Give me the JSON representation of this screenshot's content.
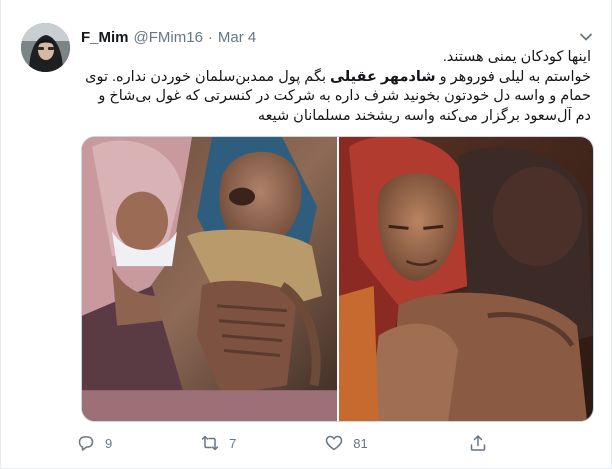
{
  "tweet": {
    "author_name": "F_Mim",
    "handle": "@FMim16",
    "separator": "·",
    "date": "Mar 4",
    "lines": [
      {
        "before": "",
        "bold": "",
        "after": "اینها کودکان یمنی هستند."
      },
      {
        "before": "خواستم به لیلی فوروهر و ",
        "bold": "شادمهر عقیلی",
        "after": " بگم پول ممدبن‌سلمان خوردن نداره. توی"
      },
      {
        "before": "",
        "bold": "",
        "after": "حمام و واسه دل خودتون بخونید شرف داره به شرکت در کنسرتی که غول بی‌شاخ و"
      },
      {
        "before": "",
        "bold": "",
        "after": "دم آل‌سعود برگزار می‌کنه واسه ریشخند مسلمانان شیعه"
      }
    ]
  },
  "actions": {
    "reply_count": "9",
    "retweet_count": "7",
    "like_count": "81"
  },
  "icons": {
    "caret": "chevron-down-icon",
    "reply": "reply-icon",
    "retweet": "retweet-icon",
    "like": "heart-icon",
    "share": "share-icon"
  },
  "colors": {
    "text": "#14171a",
    "muted": "#657786",
    "border": "#e6ecf0"
  }
}
